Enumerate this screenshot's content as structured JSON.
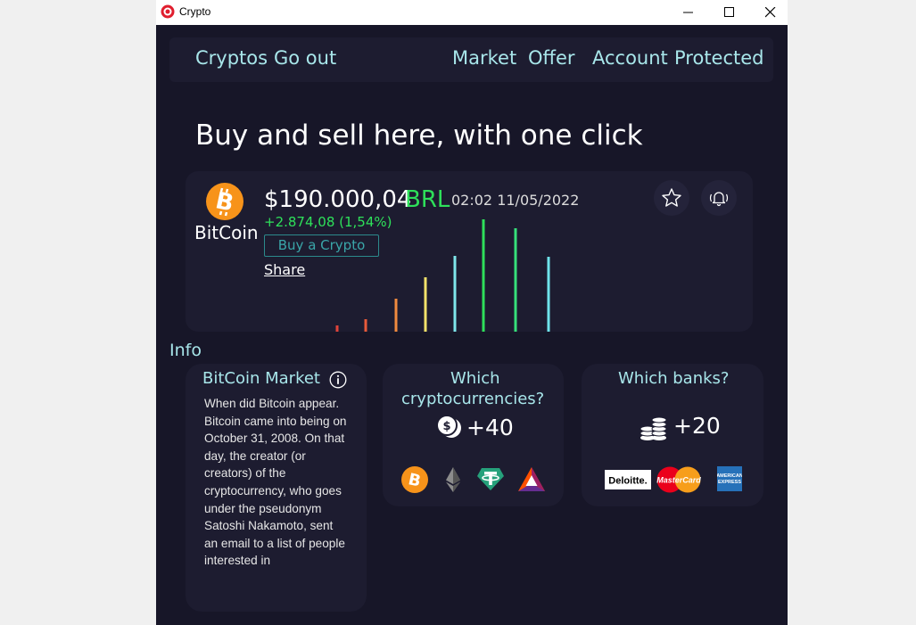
{
  "window": {
    "title": "Crypto"
  },
  "nav": {
    "cryptos": "Cryptos",
    "go_out": "Go out",
    "market": "Market",
    "offer": "Offer",
    "account": "Account",
    "protected": "Protected"
  },
  "headline": "Buy and sell here, with one click",
  "ticker": {
    "coin_name": "BitCoin",
    "price": "$190.000,04",
    "currency": "BRL",
    "timestamp": "02:02 11/05/2022",
    "change": "+2.874,08 (1,54%)",
    "buy_label": "Buy a Crypto",
    "share_label": "Share",
    "chart_bar_colors": [
      "#e0433a",
      "#e85a3a",
      "#f08a3e",
      "#f3e26a",
      "#7ee6ea",
      "#2ee05a",
      "#36e07a",
      "#6fe3ea"
    ]
  },
  "info": {
    "label": "Info",
    "market_card": {
      "title": "BitCoin Market",
      "text": "When did Bitcoin appear. Bitcoin came into being on October 31, 2008. On that day, the creator (or creators) of the cryptocurrency, who goes under the pseudonym Satoshi Nakamoto, sent an email to a list of people interested in"
    },
    "crypto_card": {
      "title_line1": "Which",
      "title_line2": "cryptocurrencies?",
      "count": "+40",
      "icons": [
        "bitcoin-icon",
        "ethereum-icon",
        "tether-icon",
        "bat-icon"
      ]
    },
    "banks_card": {
      "title": "Which banks?",
      "count": "+20",
      "logos": [
        "deloitte-logo",
        "mastercard-logo",
        "amex-logo"
      ],
      "deloitte_text": "Deloitte.",
      "mastercard_text": "MasterCard",
      "amex_text": "AMERICAN EXPRESS"
    }
  }
}
